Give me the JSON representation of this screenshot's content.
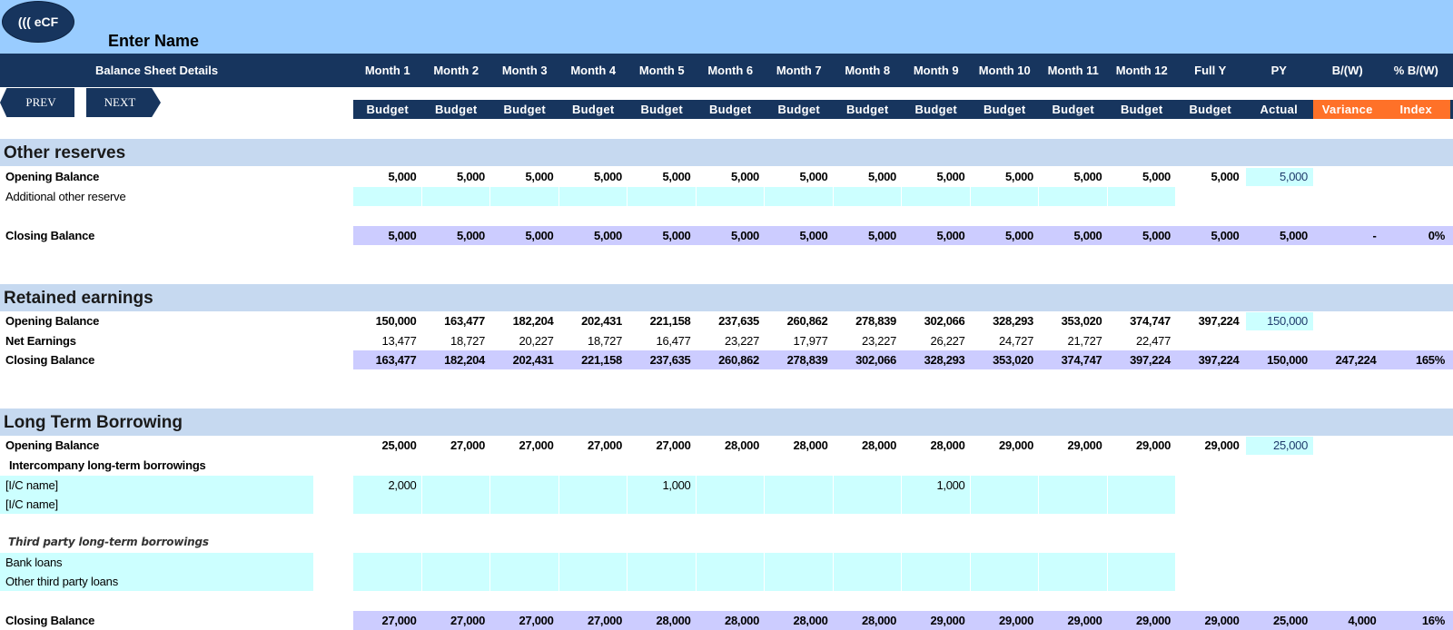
{
  "header": {
    "logo": "((( eCF",
    "entity_name": "Enter Name",
    "section_title": "Balance Sheet  Details"
  },
  "nav": {
    "prev": "PREV",
    "next": "NEXT"
  },
  "columns": {
    "periods": [
      "Month 1",
      "Month 2",
      "Month 3",
      "Month 4",
      "Month 5",
      "Month 6",
      "Month 7",
      "Month 8",
      "Month 9",
      "Month 10",
      "Month 11",
      "Month 12",
      "Full Y",
      "PY",
      "B/(W)",
      "% B/(W)"
    ],
    "types": [
      "Budget",
      "Budget",
      "Budget",
      "Budget",
      "Budget",
      "Budget",
      "Budget",
      "Budget",
      "Budget",
      "Budget",
      "Budget",
      "Budget",
      "Budget",
      "Actual",
      "Variance",
      "Index"
    ]
  },
  "colors": {
    "navy": "#17355e",
    "sky": "#99ccff",
    "section": "#c6d9f0",
    "lavender": "#ccccff",
    "input_cyan": "#ccffff",
    "orange": "#ff7128"
  },
  "sections": [
    {
      "title": "Other reserves",
      "rows": [
        {
          "label": "Opening Balance",
          "style": "bold",
          "values": [
            "5,000",
            "5,000",
            "5,000",
            "5,000",
            "5,000",
            "5,000",
            "5,000",
            "5,000",
            "5,000",
            "5,000",
            "5,000",
            "5,000",
            "5,000",
            "5,000",
            "",
            ""
          ]
        },
        {
          "label": "Additional other reserve",
          "style": "input",
          "values": [
            "",
            "",
            "",
            "",
            "",
            "",
            "",
            "",
            "",
            "",
            "",
            "",
            "",
            "",
            "",
            ""
          ]
        },
        {
          "label": "Closing Balance",
          "style": "total",
          "values": [
            "5,000",
            "5,000",
            "5,000",
            "5,000",
            "5,000",
            "5,000",
            "5,000",
            "5,000",
            "5,000",
            "5,000",
            "5,000",
            "5,000",
            "5,000",
            "5,000",
            "-",
            "0%"
          ]
        }
      ]
    },
    {
      "title": "Retained earnings",
      "rows": [
        {
          "label": "Opening Balance",
          "style": "bold",
          "values": [
            "150,000",
            "163,477",
            "182,204",
            "202,431",
            "221,158",
            "237,635",
            "260,862",
            "278,839",
            "302,066",
            "328,293",
            "353,020",
            "374,747",
            "397,224",
            "150,000",
            "",
            ""
          ]
        },
        {
          "label": "Net Earnings",
          "style": "bold-label",
          "values": [
            "13,477",
            "18,727",
            "20,227",
            "18,727",
            "16,477",
            "23,227",
            "17,977",
            "23,227",
            "26,227",
            "24,727",
            "21,727",
            "22,477",
            "",
            "",
            "",
            ""
          ]
        },
        {
          "label": "Closing Balance",
          "style": "total",
          "values": [
            "163,477",
            "182,204",
            "202,431",
            "221,158",
            "237,635",
            "260,862",
            "278,839",
            "302,066",
            "328,293",
            "353,020",
            "374,747",
            "397,224",
            "397,224",
            "150,000",
            "247,224",
            "165%"
          ]
        }
      ]
    },
    {
      "title": "Long Term Borrowing",
      "rows": [
        {
          "label": "Opening Balance",
          "style": "bold",
          "values": [
            "25,000",
            "27,000",
            "27,000",
            "27,000",
            "27,000",
            "28,000",
            "28,000",
            "28,000",
            "28,000",
            "29,000",
            "29,000",
            "29,000",
            "29,000",
            "25,000",
            "",
            ""
          ]
        },
        {
          "label": "Intercompany long-term borrowings",
          "style": "subheading",
          "values": []
        },
        {
          "label": "[I/C name]",
          "style": "input",
          "values": [
            "2,000",
            "",
            "",
            "",
            "1,000",
            "",
            "",
            "",
            "1,000",
            "",
            "",
            "",
            "",
            "",
            "",
            ""
          ]
        },
        {
          "label": "[I/C name]",
          "style": "input",
          "values": [
            "",
            "",
            "",
            "",
            "",
            "",
            "",
            "",
            "",
            "",
            "",
            "",
            "",
            "",
            "",
            ""
          ]
        },
        {
          "label": "Third party long-term borrowings",
          "style": "subheading-italic",
          "values": []
        },
        {
          "label": "Bank loans",
          "style": "input",
          "values": [
            "",
            "",
            "",
            "",
            "",
            "",
            "",
            "",
            "",
            "",
            "",
            "",
            "",
            "",
            "",
            ""
          ]
        },
        {
          "label": "Other third party loans",
          "style": "input",
          "values": [
            "",
            "",
            "",
            "",
            "",
            "",
            "",
            "",
            "",
            "",
            "",
            "",
            "",
            "",
            "",
            ""
          ]
        },
        {
          "label": "Closing Balance",
          "style": "total",
          "values": [
            "27,000",
            "27,000",
            "27,000",
            "27,000",
            "28,000",
            "28,000",
            "28,000",
            "28,000",
            "29,000",
            "29,000",
            "29,000",
            "29,000",
            "29,000",
            "25,000",
            "4,000",
            "16%"
          ]
        }
      ]
    }
  ]
}
